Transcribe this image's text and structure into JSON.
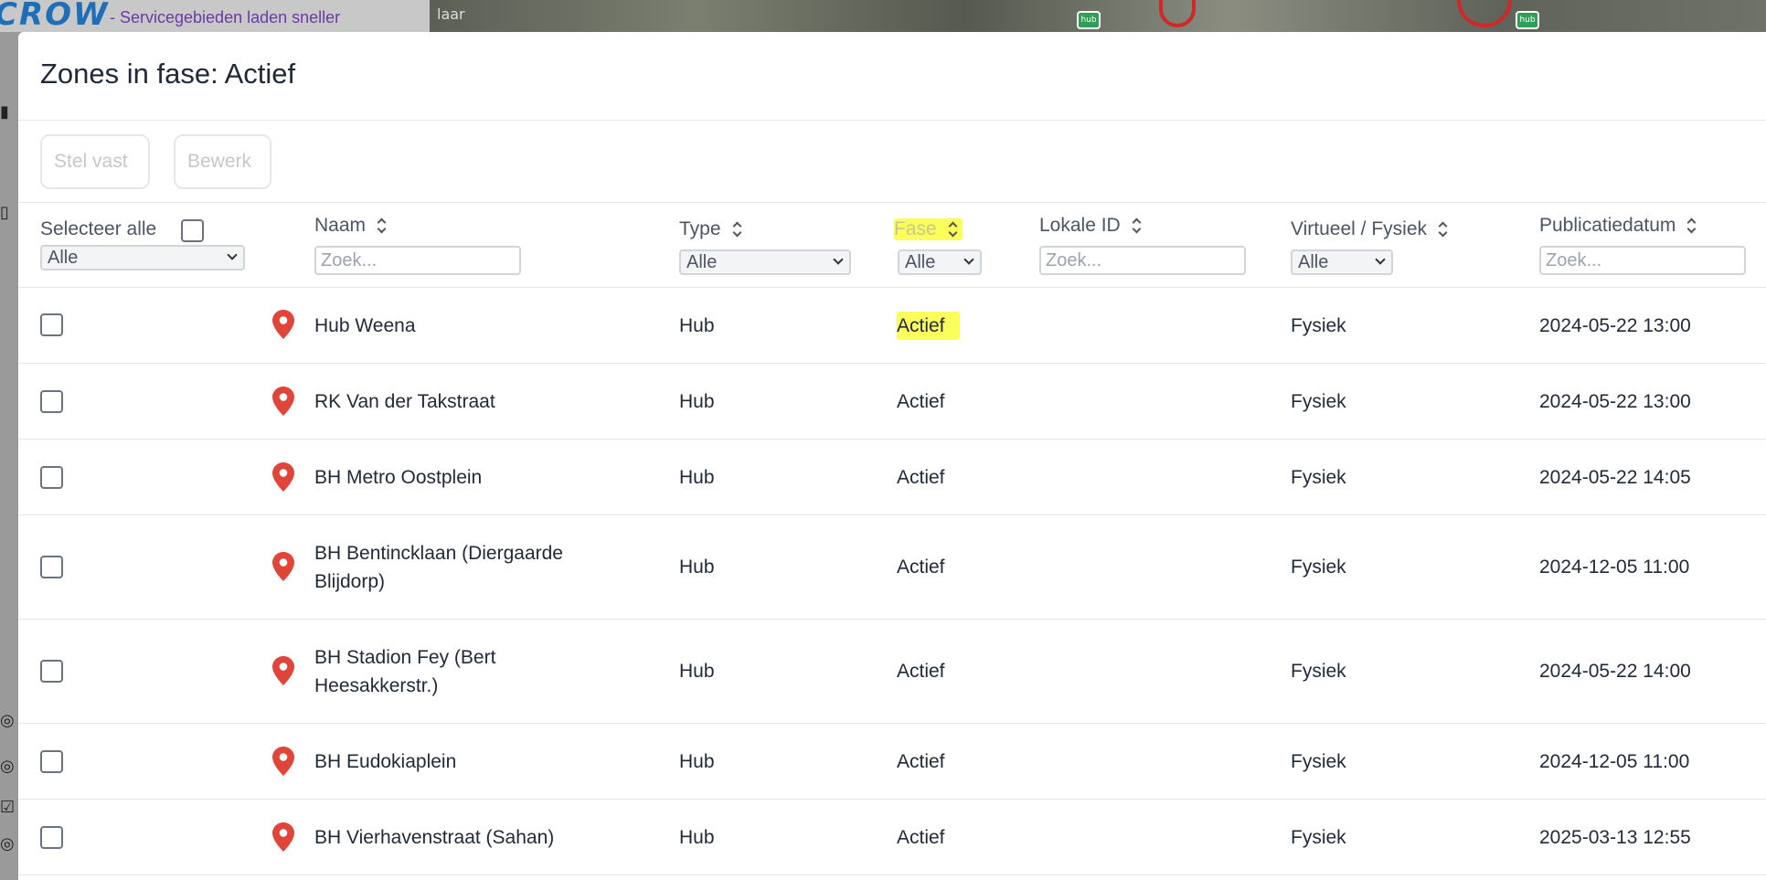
{
  "background": {
    "logo": "CROW",
    "news_line": "- Servicegebieden laden sneller",
    "map_label": "laar",
    "map_hub_label": "hub"
  },
  "modal": {
    "title": "Zones in fase: Actief",
    "buttons": {
      "confirm_label": "Stel vast",
      "edit_label": "Bewerk"
    }
  },
  "table": {
    "select_all_label": "Selecteer alle",
    "headers": {
      "naam": "Naam",
      "type": "Type",
      "fase": "Fase",
      "lokale_id": "Lokale ID",
      "virtueel": "Virtueel / Fysiek",
      "publicatiedatum": "Publicatiedatum"
    },
    "filters": {
      "select_all_value": "Alle",
      "type_value": "Alle",
      "fase_value": "Alle",
      "virtueel_value": "Alle",
      "search_placeholder": "Zoek..."
    },
    "rows": [
      {
        "naam": "Hub Weena",
        "type": "Hub",
        "fase": "Actief",
        "lokale_id": "",
        "virtueel": "Fysiek",
        "datum": "2024-05-22 13:00"
      },
      {
        "naam": "RK Van der Takstraat",
        "type": "Hub",
        "fase": "Actief",
        "lokale_id": "",
        "virtueel": "Fysiek",
        "datum": "2024-05-22 13:00"
      },
      {
        "naam": "BH Metro Oostplein",
        "type": "Hub",
        "fase": "Actief",
        "lokale_id": "",
        "virtueel": "Fysiek",
        "datum": "2024-05-22 14:05"
      },
      {
        "naam": "BH Bentincklaan (Diergaarde Blijdorp)",
        "type": "Hub",
        "fase": "Actief",
        "lokale_id": "",
        "virtueel": "Fysiek",
        "datum": "2024-12-05 11:00"
      },
      {
        "naam": "BH Stadion Fey (Bert Heesakkerstr.)",
        "type": "Hub",
        "fase": "Actief",
        "lokale_id": "",
        "virtueel": "Fysiek",
        "datum": "2024-05-22 14:00"
      },
      {
        "naam": "BH Eudokiaplein",
        "type": "Hub",
        "fase": "Actief",
        "lokale_id": "",
        "virtueel": "Fysiek",
        "datum": "2024-12-05 11:00"
      },
      {
        "naam": "BH Vierhavenstraat (Sahan)",
        "type": "Hub",
        "fase": "Actief",
        "lokale_id": "",
        "virtueel": "Fysiek",
        "datum": "2025-03-13 12:55"
      }
    ]
  },
  "colors": {
    "highlight": "#fbff5c",
    "pin": "#e0453a"
  }
}
